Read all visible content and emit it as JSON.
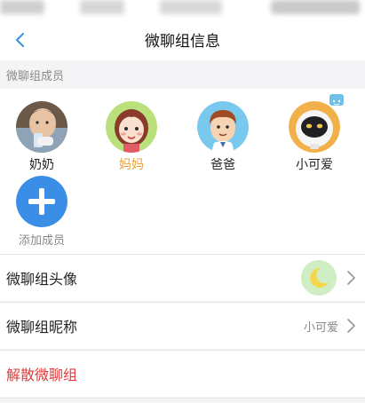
{
  "header": {
    "title": "微聊组信息"
  },
  "members_section": {
    "label": "微聊组成员",
    "members": [
      {
        "name": "奶奶",
        "avatar_icon": "baby-photo-avatar",
        "highlighted": false
      },
      {
        "name": "妈妈",
        "avatar_icon": "girl-cartoon-avatar",
        "highlighted": true
      },
      {
        "name": "爸爸",
        "avatar_icon": "boy-cartoon-avatar",
        "highlighted": false
      },
      {
        "name": "小可爱",
        "avatar_icon": "robot-watch-avatar",
        "highlighted": false
      }
    ],
    "add_label": "添加成员"
  },
  "settings": {
    "avatar_label": "微聊组头像",
    "avatar_icon": "moon-icon",
    "nickname_label": "微聊组昵称",
    "nickname_value": "小可爱",
    "dissolve_label": "解散微聊组"
  },
  "colors": {
    "accent_blue": "#3a8ee6",
    "highlight_orange": "#e8a23a",
    "danger_red": "#e03a3a"
  }
}
